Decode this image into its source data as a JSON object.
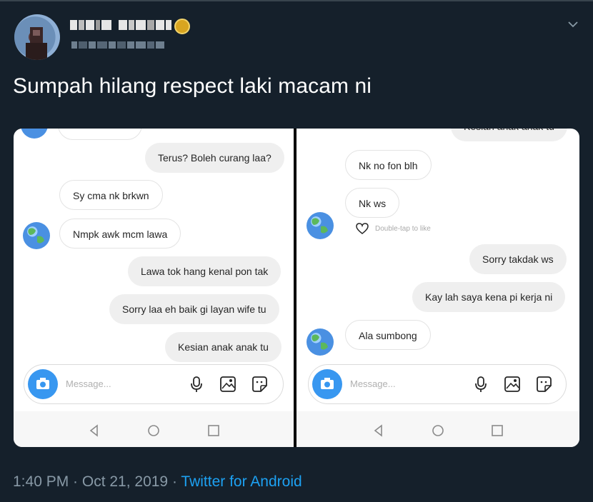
{
  "tweet": {
    "text": "Sumpah hilang respect laki macam ni",
    "time": "1:40 PM · Oct 21, 2019 ·",
    "source": "Twitter for Android",
    "accent_color": "#1da1f2"
  },
  "left_chat": {
    "messages": [
      {
        "text": "Terus? Boleh curang laa?",
        "side": "out"
      },
      {
        "text": "Sy cma nk brkwn",
        "side": "in"
      },
      {
        "text": "Nmpk awk mcm lawa",
        "side": "in"
      },
      {
        "text": "Lawa tok hang kenal pon tak",
        "side": "out"
      },
      {
        "text": "Sorry laa eh baik gi layan wife tu",
        "side": "out"
      },
      {
        "text": "Kesian anak anak tu",
        "side": "out"
      }
    ],
    "placeholder": "Message..."
  },
  "right_chat": {
    "messages": [
      {
        "text": "Kesian anak anak tu",
        "side": "out"
      },
      {
        "text": "Nk no fon blh",
        "side": "in"
      },
      {
        "text": "Nk ws",
        "side": "in"
      },
      {
        "text": "Sorry takdak ws",
        "side": "out"
      },
      {
        "text": "Kay lah saya kena pi kerja ni",
        "side": "out"
      },
      {
        "text": "Ala sumbong",
        "side": "in"
      }
    ],
    "double_tap": "Double-tap to like",
    "placeholder": "Message..."
  },
  "icons": [
    "chevron-down-icon",
    "verified-icon",
    "camera-icon",
    "mic-icon",
    "gallery-icon",
    "sticker-icon",
    "heart-icon",
    "back-icon",
    "home-icon",
    "recents-icon",
    "globe-avatar-icon"
  ]
}
